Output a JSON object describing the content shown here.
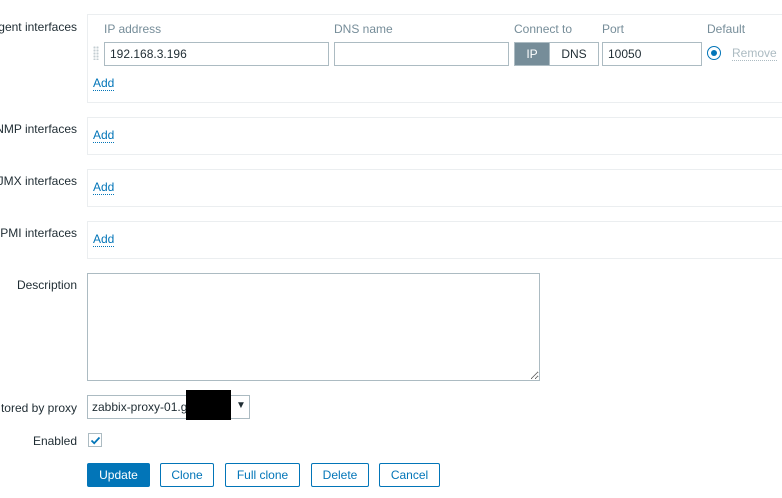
{
  "interfaces": {
    "agent": {
      "label": "gent interfaces",
      "columns": {
        "ip": "IP address",
        "dns": "DNS name",
        "connect": "Connect to",
        "port": "Port",
        "default": "Default"
      },
      "row": {
        "ip_value": "192.168.3.196",
        "dns_value": "",
        "connect_ip": "IP",
        "connect_dns": "DNS",
        "connect_selected": "IP",
        "port_value": "10050",
        "default_selected": true,
        "remove_label": "Remove"
      },
      "add_label": "Add"
    },
    "snmp": {
      "label": "NMP interfaces",
      "add_label": "Add"
    },
    "jmx": {
      "label": "JMX interfaces",
      "add_label": "Add"
    },
    "ipmi": {
      "label": "PMI interfaces",
      "add_label": "Add"
    }
  },
  "description": {
    "label": "Description",
    "value": ""
  },
  "proxy": {
    "label": "tored by proxy",
    "selected": "zabbix-proxy-01.g"
  },
  "enabled": {
    "label": "Enabled",
    "checked": true
  },
  "buttons": {
    "update": "Update",
    "clone": "Clone",
    "full_clone": "Full clone",
    "delete": "Delete",
    "cancel": "Cancel"
  },
  "colors": {
    "accent": "#0275b8",
    "toggle_active": "#768d99",
    "border": "#acbbc2"
  },
  "icons": {
    "check": "check-icon",
    "caret": "caret-down-icon",
    "drag": "drag-handle-icon"
  }
}
